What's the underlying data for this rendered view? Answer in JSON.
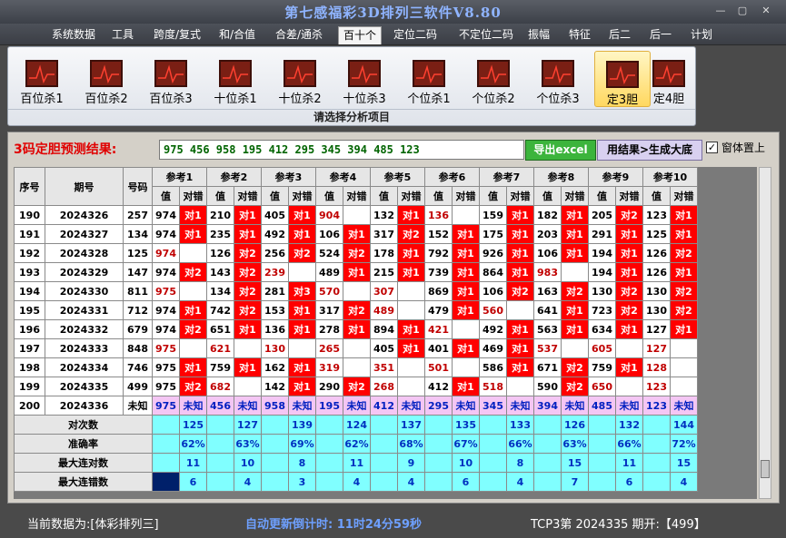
{
  "window": {
    "title": "第七感福彩3D排列三软件V8.80",
    "btn_min": "—",
    "btn_max": "▢",
    "btn_close": "✕"
  },
  "menu": [
    "系统数据",
    "工具",
    "跨度/复式",
    "和/合值",
    "合差/通杀",
    "百十个",
    "定位二码",
    "不定位二码",
    "振幅",
    "特征",
    "后二",
    "后一",
    "计划"
  ],
  "menu_active": 5,
  "ribbon": {
    "items": [
      "百位杀1",
      "百位杀2",
      "百位杀3",
      "十位杀1",
      "十位杀2",
      "十位杀3",
      "个位杀1",
      "个位杀2",
      "个位杀3",
      "定3胆",
      "定4胆"
    ],
    "selected": 9,
    "caption": "请选择分析项目"
  },
  "prediction": {
    "label": "3码定胆预测结果:",
    "value": "975 456 958 195 412 295 345 394 485 123",
    "excel_btn": "导出excel",
    "gen_btn": "用结果>生成大底",
    "check": "✓",
    "check_label": "窗体置上"
  },
  "table": {
    "h_seq": "序号",
    "h_period": "期号",
    "h_num": "号码",
    "refs": [
      "参考1",
      "参考2",
      "参考3",
      "参考4",
      "参考5",
      "参考6",
      "参考7",
      "参考8",
      "参考9",
      "参考10"
    ],
    "h_val": "值",
    "h_judge": "对错",
    "rows": [
      {
        "seq": "190",
        "period": "2024326",
        "num": "257",
        "cells": [
          [
            "974",
            "对1"
          ],
          [
            "210",
            "对1"
          ],
          [
            "405",
            "对1"
          ],
          [
            "904",
            "r"
          ],
          [
            "132",
            "对1"
          ],
          [
            "136",
            "r"
          ],
          [
            "159",
            "对1"
          ],
          [
            "182",
            "对1"
          ],
          [
            "205",
            "对2"
          ],
          [
            "123",
            "对1"
          ]
        ]
      },
      {
        "seq": "191",
        "period": "2024327",
        "num": "134",
        "cells": [
          [
            "974",
            "对1"
          ],
          [
            "235",
            "对1"
          ],
          [
            "492",
            "对1"
          ],
          [
            "106",
            "对1"
          ],
          [
            "317",
            "对2"
          ],
          [
            "152",
            "对1"
          ],
          [
            "175",
            "对1"
          ],
          [
            "203",
            "对1"
          ],
          [
            "291",
            "对1"
          ],
          [
            "125",
            "对1"
          ]
        ]
      },
      {
        "seq": "192",
        "period": "2024328",
        "num": "125",
        "cells": [
          [
            "974",
            "r"
          ],
          [
            "126",
            "对2"
          ],
          [
            "256",
            "对2"
          ],
          [
            "524",
            "对2"
          ],
          [
            "178",
            "对1"
          ],
          [
            "792",
            "对1"
          ],
          [
            "926",
            "对1"
          ],
          [
            "106",
            "对1"
          ],
          [
            "194",
            "对1"
          ],
          [
            "126",
            "对2"
          ]
        ]
      },
      {
        "seq": "193",
        "period": "2024329",
        "num": "147",
        "cells": [
          [
            "974",
            "对2"
          ],
          [
            "143",
            "对2"
          ],
          [
            "239",
            "r"
          ],
          [
            "489",
            "对1"
          ],
          [
            "215",
            "对1"
          ],
          [
            "739",
            "对1"
          ],
          [
            "864",
            "对1"
          ],
          [
            "983",
            "r"
          ],
          [
            "194",
            "对1"
          ],
          [
            "126",
            "对1"
          ]
        ]
      },
      {
        "seq": "194",
        "period": "2024330",
        "num": "811",
        "cells": [
          [
            "975",
            "r"
          ],
          [
            "134",
            "对2"
          ],
          [
            "281",
            "对3"
          ],
          [
            "570",
            "r"
          ],
          [
            "307",
            "r"
          ],
          [
            "869",
            "对1"
          ],
          [
            "106",
            "对2"
          ],
          [
            "163",
            "对2"
          ],
          [
            "130",
            "对2"
          ],
          [
            "130",
            "对2"
          ]
        ]
      },
      {
        "seq": "195",
        "period": "2024331",
        "num": "712",
        "cells": [
          [
            "974",
            "对1"
          ],
          [
            "742",
            "对2"
          ],
          [
            "153",
            "对1"
          ],
          [
            "317",
            "对2"
          ],
          [
            "489",
            "r"
          ],
          [
            "479",
            "对1"
          ],
          [
            "560",
            "r"
          ],
          [
            "641",
            "对1"
          ],
          [
            "723",
            "对2"
          ],
          [
            "130",
            "对2"
          ]
        ]
      },
      {
        "seq": "196",
        "period": "2024332",
        "num": "679",
        "cells": [
          [
            "974",
            "对2"
          ],
          [
            "651",
            "对1"
          ],
          [
            "136",
            "对1"
          ],
          [
            "278",
            "对1"
          ],
          [
            "894",
            "对1"
          ],
          [
            "421",
            "r"
          ],
          [
            "492",
            "对1"
          ],
          [
            "563",
            "对1"
          ],
          [
            "634",
            "对1"
          ],
          [
            "127",
            "对1"
          ]
        ]
      },
      {
        "seq": "197",
        "period": "2024333",
        "num": "848",
        "cells": [
          [
            "975",
            "r"
          ],
          [
            "621",
            "r"
          ],
          [
            "130",
            "r"
          ],
          [
            "265",
            "r"
          ],
          [
            "405",
            "对1"
          ],
          [
            "401",
            "对1"
          ],
          [
            "469",
            "对1"
          ],
          [
            "537",
            "r"
          ],
          [
            "605",
            "r"
          ],
          [
            "127",
            "r"
          ]
        ]
      },
      {
        "seq": "198",
        "period": "2024334",
        "num": "746",
        "cells": [
          [
            "975",
            "对1"
          ],
          [
            "759",
            "对1"
          ],
          [
            "162",
            "对1"
          ],
          [
            "319",
            "r"
          ],
          [
            "351",
            "r"
          ],
          [
            "501",
            "r"
          ],
          [
            "586",
            "对1"
          ],
          [
            "671",
            "对2"
          ],
          [
            "759",
            "对1"
          ],
          [
            "128",
            "r"
          ]
        ]
      },
      {
        "seq": "199",
        "period": "2024335",
        "num": "499",
        "cells": [
          [
            "975",
            "对2"
          ],
          [
            "682",
            "r"
          ],
          [
            "142",
            "对1"
          ],
          [
            "290",
            "对2"
          ],
          [
            "268",
            "r"
          ],
          [
            "412",
            "对1"
          ],
          [
            "518",
            "r"
          ],
          [
            "590",
            "对2"
          ],
          [
            "650",
            "r"
          ],
          [
            "123",
            "r"
          ]
        ]
      }
    ],
    "last": {
      "seq": "200",
      "period": "2024336",
      "num": "未知",
      "vals": [
        "975",
        "456",
        "958",
        "195",
        "412",
        "295",
        "345",
        "394",
        "485",
        "123"
      ],
      "unk": "未知"
    },
    "stats": [
      {
        "label": "对次数",
        "vals": [
          "125",
          "127",
          "139",
          "124",
          "137",
          "135",
          "133",
          "126",
          "132",
          "144"
        ]
      },
      {
        "label": "准确率",
        "vals": [
          "62%",
          "63%",
          "69%",
          "62%",
          "68%",
          "67%",
          "66%",
          "63%",
          "66%",
          "72%"
        ]
      },
      {
        "label": "最大连对数",
        "vals": [
          "11",
          "10",
          "8",
          "11",
          "9",
          "10",
          "8",
          "15",
          "11",
          "15"
        ]
      },
      {
        "label": "最大连错数",
        "vals": [
          "6",
          "4",
          "3",
          "4",
          "4",
          "6",
          "4",
          "7",
          "6",
          "4"
        ]
      }
    ]
  },
  "status": {
    "source": "当前数据为:[体彩排列三]",
    "countdown": "自动更新倒计时: 11时24分59秒",
    "draw": "TCP3第 2024335 期开:【499】"
  }
}
